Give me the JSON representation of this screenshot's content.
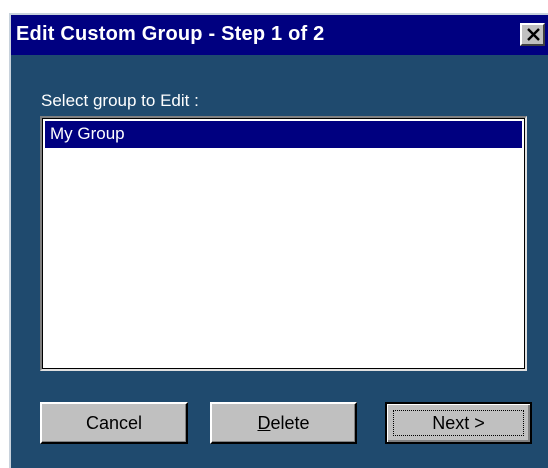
{
  "window": {
    "title": "Edit Custom Group - Step 1 of 2",
    "close_icon": "close-icon"
  },
  "prompt": {
    "label": "Select group to Edit :"
  },
  "group_list": {
    "items": [
      {
        "label": "My Group",
        "selected": true
      }
    ]
  },
  "buttons": {
    "cancel": {
      "label": "Cancel"
    },
    "delete": {
      "mnemonic": "D",
      "rest": "elete"
    },
    "next": {
      "label": "Next >"
    }
  },
  "colors": {
    "titlebar": "#000080",
    "dialog_background": "#1f4a6e",
    "selection": "#000080",
    "button_face": "#c0c0c0"
  }
}
